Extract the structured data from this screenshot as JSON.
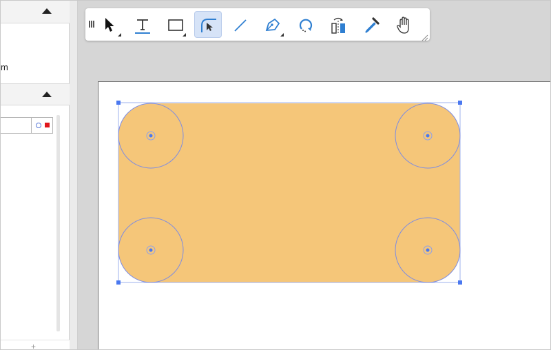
{
  "left_panel": {
    "units_fragment": "m",
    "stroke_placeholder": "",
    "add_symbol": "+"
  },
  "toolbar": {
    "tools": [
      {
        "name": "select-tool",
        "icon": "pointer-arrow-icon",
        "active": false
      },
      {
        "name": "text-tool",
        "icon": "text-t-icon",
        "active": false
      },
      {
        "name": "rectangle-tool",
        "icon": "rectangle-icon",
        "active": false
      },
      {
        "name": "corner-radius-tool",
        "icon": "corner-radius-icon",
        "active": true
      },
      {
        "name": "line-tool",
        "icon": "line-icon",
        "active": false
      },
      {
        "name": "pen-tool",
        "icon": "pen-nib-icon",
        "active": false
      },
      {
        "name": "rotate-tool",
        "icon": "rotate-icon",
        "active": false
      },
      {
        "name": "mirror-tool",
        "icon": "mirror-icon",
        "active": false
      },
      {
        "name": "eyedropper-tool",
        "icon": "eyedropper-icon",
        "active": false
      },
      {
        "name": "hand-tool",
        "icon": "hand-icon",
        "active": false
      }
    ]
  },
  "shape": {
    "type": "rounded-rectangle",
    "fill": "#f5c679",
    "stroke": "#7c8ce3",
    "handle_color": "#4a78f0"
  },
  "colors": {
    "accent": "#2f7fd1",
    "active_tool_bg": "#d6e3f7",
    "swatch_red": "#e0161c"
  }
}
